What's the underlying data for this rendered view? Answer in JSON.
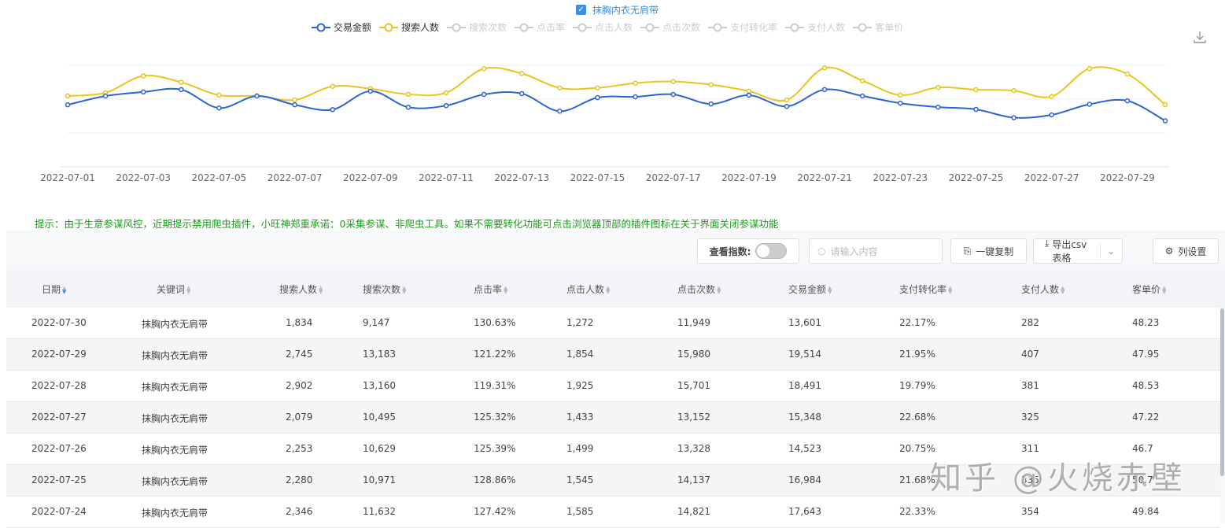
{
  "keyword_filter": {
    "label": "抹胸内衣无肩带",
    "checked": true
  },
  "legend": [
    {
      "label": "交易金额",
      "color": "#2e64d1",
      "active": true
    },
    {
      "label": "搜索人数",
      "color": "#e8c521",
      "active": true
    },
    {
      "label": "搜索次数",
      "color": "#cccccc",
      "active": false
    },
    {
      "label": "点击率",
      "color": "#cccccc",
      "active": false
    },
    {
      "label": "点击人数",
      "color": "#cccccc",
      "active": false
    },
    {
      "label": "点击次数",
      "color": "#cccccc",
      "active": false
    },
    {
      "label": "支付转化率",
      "color": "#cccccc",
      "active": false
    },
    {
      "label": "支付人数",
      "color": "#cccccc",
      "active": false
    },
    {
      "label": "客单价",
      "color": "#cccccc",
      "active": false
    }
  ],
  "download_icon": "download-icon",
  "chart_data": {
    "type": "line",
    "x": [
      "2022-07-01",
      "2022-07-02",
      "2022-07-03",
      "2022-07-04",
      "2022-07-05",
      "2022-07-06",
      "2022-07-07",
      "2022-07-08",
      "2022-07-09",
      "2022-07-10",
      "2022-07-11",
      "2022-07-12",
      "2022-07-13",
      "2022-07-14",
      "2022-07-15",
      "2022-07-16",
      "2022-07-17",
      "2022-07-18",
      "2022-07-19",
      "2022-07-20",
      "2022-07-21",
      "2022-07-22",
      "2022-07-23",
      "2022-07-24",
      "2022-07-25",
      "2022-07-26",
      "2022-07-27",
      "2022-07-28",
      "2022-07-29",
      "2022-07-30"
    ],
    "xtick_labels": [
      "2022-07-01",
      "2022-07-03",
      "2022-07-05",
      "2022-07-07",
      "2022-07-09",
      "2022-07-11",
      "2022-07-13",
      "2022-07-15",
      "2022-07-17",
      "2022-07-19",
      "2022-07-21",
      "2022-07-23",
      "2022-07-25",
      "2022-07-27",
      "2022-07-29"
    ],
    "series": [
      {
        "name": "交易金额",
        "color": "#2e64d1",
        "ylim": [
          0,
          40000
        ],
        "values": [
          18331,
          20933,
          22115,
          22825,
          17385,
          20933,
          18331,
          16912,
          22352,
          17622,
          18095,
          21406,
          21642,
          16439,
          20460,
          20696,
          21406,
          18568,
          21169,
          17858,
          22825,
          20933,
          18804,
          17643,
          16984,
          14523,
          15348,
          18491,
          19514,
          13601
        ]
      },
      {
        "name": "搜索人数",
        "color": "#e8c521",
        "ylim": [
          0,
          4000
        ],
        "values": [
          2095,
          2190,
          2687,
          2498,
          2118,
          2095,
          1976,
          2379,
          2308,
          2142,
          2190,
          2901,
          2758,
          2332,
          2332,
          2474,
          2521,
          2427,
          2237,
          1976,
          2924,
          2545,
          2118,
          2346,
          2280,
          2253,
          2079,
          2902,
          2745,
          1834
        ]
      }
    ],
    "grid": true,
    "yaxis_labels_visible": false
  },
  "notice": "提示：由于生意参谋风控，近期提示禁用爬虫插件，小旺神郑重承诺：0采集参谋、非爬虫工具。如果不需要转化功能可点击浏览器顶部的插件图标在关于界面关闭参谋功能",
  "toolbar": {
    "index_label": "查看指数:",
    "index_on": false,
    "search_placeholder": "请输入内容",
    "copy_label": "一键复制",
    "export_label": "导出csv表格",
    "columns_label": "列设置"
  },
  "table": {
    "columns": [
      "日期",
      "关键词",
      "搜索人数",
      "搜索次数",
      "点击率",
      "点击人数",
      "点击次数",
      "交易金额",
      "支付转化率",
      "支付人数",
      "客单价"
    ],
    "rows": [
      [
        "2022-07-30",
        "抹胸内衣无肩带",
        "1,834",
        "9,147",
        "130.63%",
        "1,272",
        "11,949",
        "13,601",
        "22.17%",
        "282",
        "48.23"
      ],
      [
        "2022-07-29",
        "抹胸内衣无肩带",
        "2,745",
        "13,183",
        "121.22%",
        "1,854",
        "15,980",
        "19,514",
        "21.95%",
        "407",
        "47.95"
      ],
      [
        "2022-07-28",
        "抹胸内衣无肩带",
        "2,902",
        "13,160",
        "119.31%",
        "1,925",
        "15,701",
        "18,491",
        "19.79%",
        "381",
        "48.53"
      ],
      [
        "2022-07-27",
        "抹胸内衣无肩带",
        "2,079",
        "10,495",
        "125.32%",
        "1,433",
        "13,152",
        "15,348",
        "22.68%",
        "325",
        "47.22"
      ],
      [
        "2022-07-26",
        "抹胸内衣无肩带",
        "2,253",
        "10,629",
        "125.39%",
        "1,499",
        "13,328",
        "14,523",
        "20.75%",
        "311",
        "46.7"
      ],
      [
        "2022-07-25",
        "抹胸内衣无肩带",
        "2,280",
        "10,971",
        "128.86%",
        "1,545",
        "14,137",
        "16,984",
        "21.68%",
        "335",
        "50.7"
      ],
      [
        "2022-07-24",
        "抹胸内衣无肩带",
        "2,346",
        "11,632",
        "127.42%",
        "1,585",
        "14,821",
        "17,643",
        "22.33%",
        "354",
        "49.84"
      ]
    ]
  },
  "watermark": "知乎 @火烧赤壁"
}
